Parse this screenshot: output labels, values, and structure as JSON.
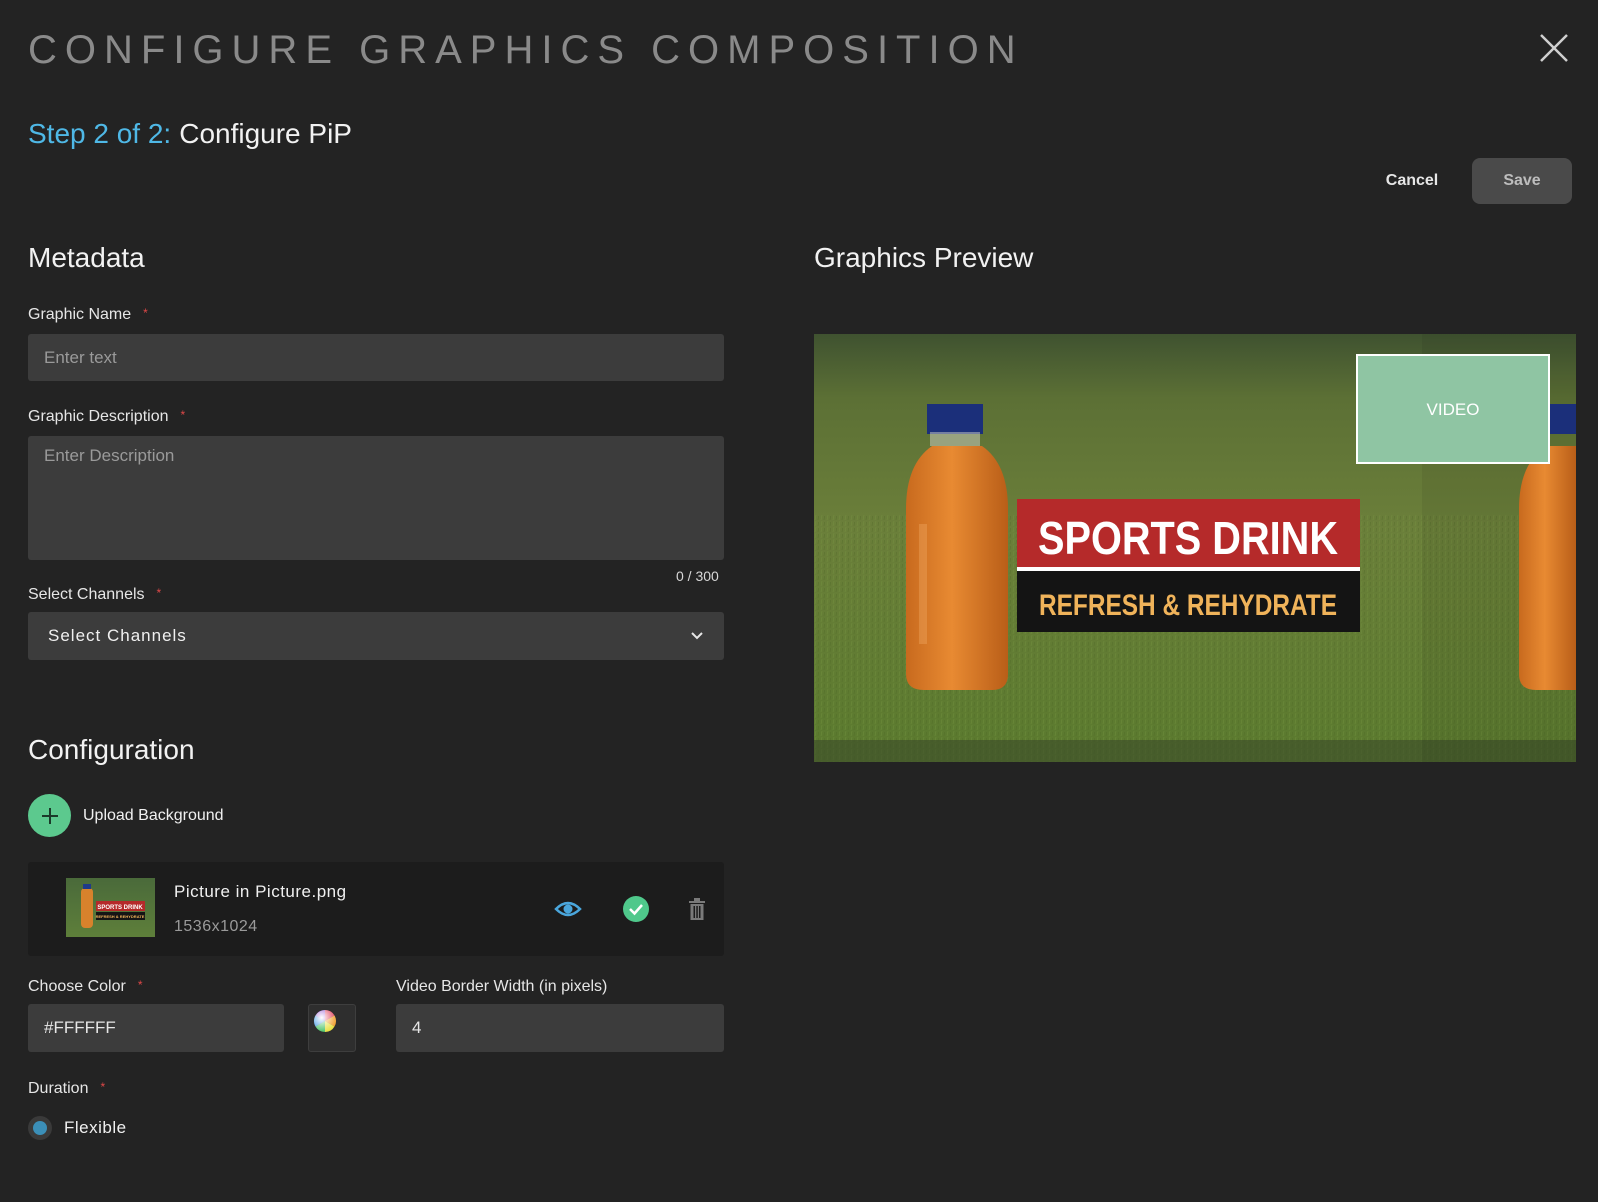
{
  "modal": {
    "title": "CONFIGURE GRAPHICS COMPOSITION",
    "step_prefix": "Step 2 of 2:",
    "step_name": "Configure PiP",
    "cancel_label": "Cancel",
    "save_label": "Save"
  },
  "metadata": {
    "title": "Metadata",
    "graphic_name": {
      "label": "Graphic Name",
      "placeholder": "Enter text",
      "value": ""
    },
    "graphic_description": {
      "label": "Graphic Description",
      "placeholder": "Enter Description",
      "value": "",
      "counter": "0 / 300"
    },
    "channels": {
      "label": "Select Channels",
      "selected": "Select Channels"
    }
  },
  "configuration": {
    "title": "Configuration",
    "upload_label": "Upload Background",
    "file": {
      "name": "Picture in Picture.png",
      "dimensions": "1536x1024",
      "thumb_title": "SPORTS DRINK",
      "thumb_subtitle": "REFRESH & REHYDRATE"
    },
    "color": {
      "label": "Choose Color",
      "value": "#FFFFFF"
    },
    "border_width": {
      "label": "Video Border Width (in pixels)",
      "value": "4"
    },
    "duration": {
      "label": "Duration",
      "option": "Flexible"
    }
  },
  "preview": {
    "title": "Graphics Preview",
    "pip_label": "VIDEO",
    "banner_title": "SPORTS DRINK",
    "banner_subtitle": "REFRESH & REHYDRATE"
  },
  "colors": {
    "accent_blue": "#4fb8e6",
    "accent_green": "#5cc98e",
    "required_red": "#e04848",
    "banner_red": "#b52a2a",
    "banner_gold": "#f0b35a",
    "pip_fill": "#8fc5a3"
  },
  "icons": {
    "close": "close-icon",
    "add": "plus-icon",
    "preview": "eye-icon",
    "selected": "check-circle-icon",
    "delete": "trash-icon",
    "dropdown": "chevron-down-icon",
    "color_picker": "color-wheel-icon"
  }
}
